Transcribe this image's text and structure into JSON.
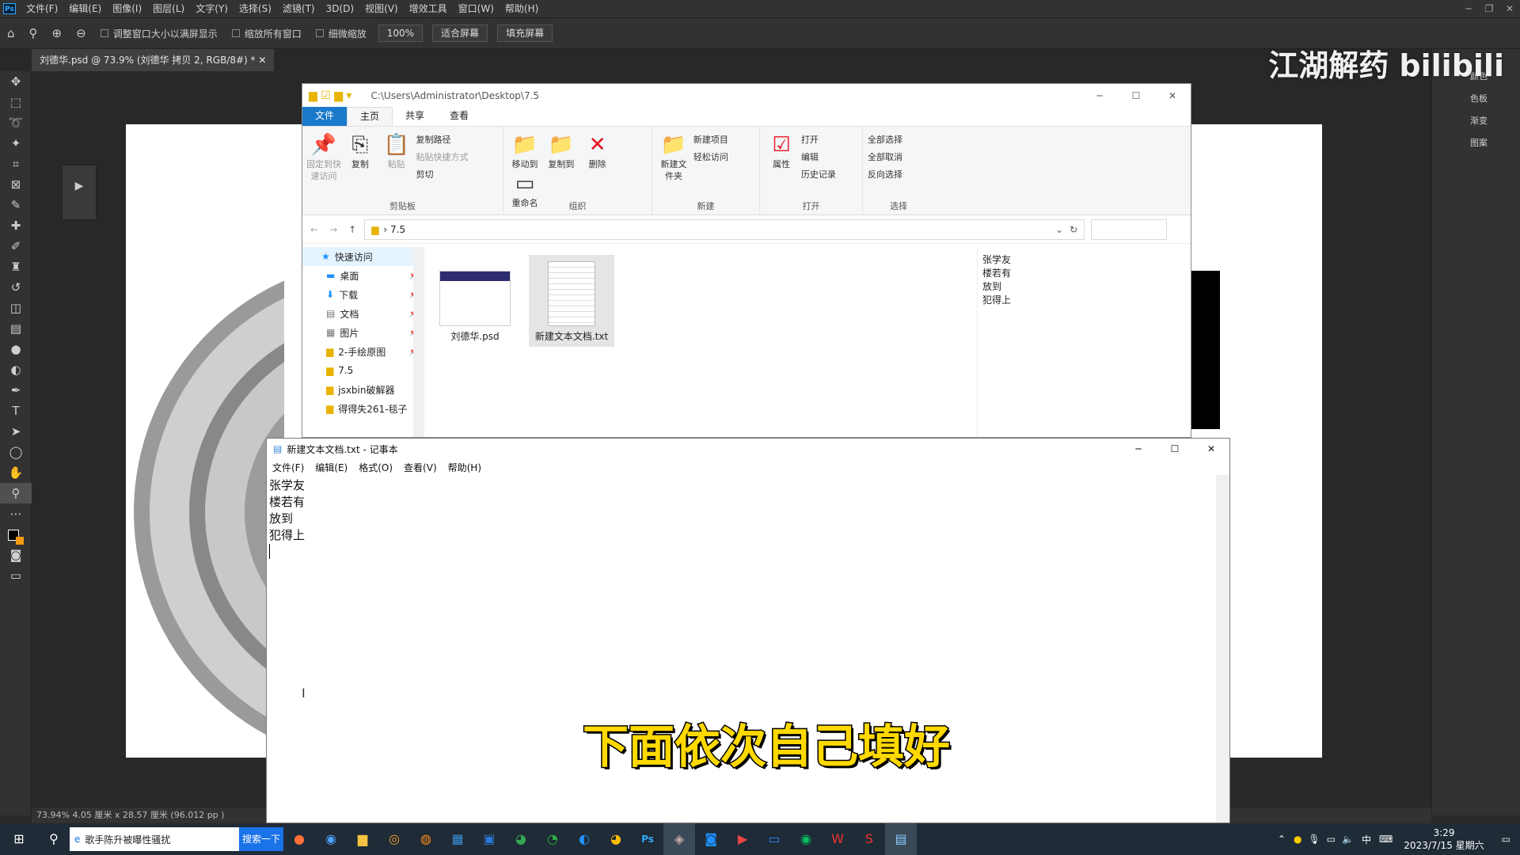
{
  "ps": {
    "menu": [
      "文件(F)",
      "编辑(E)",
      "图像(I)",
      "图层(L)",
      "文字(Y)",
      "选择(S)",
      "滤镜(T)",
      "3D(D)",
      "视图(V)",
      "增效工具",
      "窗口(W)",
      "帮助(H)"
    ],
    "options": {
      "resize_windows": "调整窗口大小以满屏显示",
      "zoom_all": "缩放所有窗口",
      "scrubby_zoom": "细微缩放",
      "zoom_value": "100%",
      "fit_screen": "适合屏幕",
      "fill_screen": "填充屏幕"
    },
    "doc_tab": "刘德华.psd @ 73.9% (刘德华 拷贝 2, RGB/8#) *",
    "status": "73.94%  4.05 厘米 x 28.57 厘米 (96.012 pp )",
    "right_panel": [
      "颜色",
      "色板",
      "渐变",
      "图案"
    ],
    "watermark": "江湖解药 bilibili"
  },
  "explorer": {
    "path_title": "C:\\Users\\Administrator\\Desktop\\7.5",
    "tabs": [
      "文件",
      "主页",
      "共享",
      "查看"
    ],
    "groups": {
      "clipboard": {
        "label": "剪贴板",
        "pin": "固定到快速访问",
        "copy": "复制",
        "paste": "粘贴",
        "copy_path": "复制路径",
        "paste_shortcut": "粘贴快捷方式",
        "cut": "剪切"
      },
      "organize": {
        "label": "组织",
        "move_to": "移动到",
        "copy_to": "复制到",
        "delete": "删除",
        "rename": "重命名"
      },
      "new": {
        "label": "新建",
        "new_folder": "新建文件夹",
        "new_item": "新建项目",
        "easy_access": "轻松访问"
      },
      "open": {
        "label": "打开",
        "properties": "属性",
        "open": "打开",
        "edit": "编辑",
        "history": "历史记录"
      },
      "select": {
        "label": "选择",
        "select_all": "全部选择",
        "select_none": "全部取消",
        "invert": "反向选择"
      }
    },
    "address": "7.5",
    "nav": [
      "快速访问",
      "桌面",
      "下载",
      "文档",
      "图片",
      "2-手绘原图",
      "7.5",
      "jsxbin破解器",
      "得得失261-毯子"
    ],
    "files": [
      "刘德华.psd",
      "新建文本文档.txt"
    ],
    "preview_lines": [
      "张学友",
      "楼若有",
      "放到",
      "犯得上"
    ]
  },
  "notepad": {
    "title": "新建文本文档.txt - 记事本",
    "menu": [
      "文件(F)",
      "编辑(E)",
      "格式(O)",
      "查看(V)",
      "帮助(H)"
    ],
    "lines": [
      "张学友",
      "楼若有",
      "放到",
      "犯得上"
    ]
  },
  "subtitle": "下面依次自己填好",
  "taskbar": {
    "search_text": "歌手陈升被曝性骚扰",
    "search_button": "搜索一下",
    "time": "3:29",
    "date": "2023/7/15 星期六",
    "ime": "中"
  }
}
